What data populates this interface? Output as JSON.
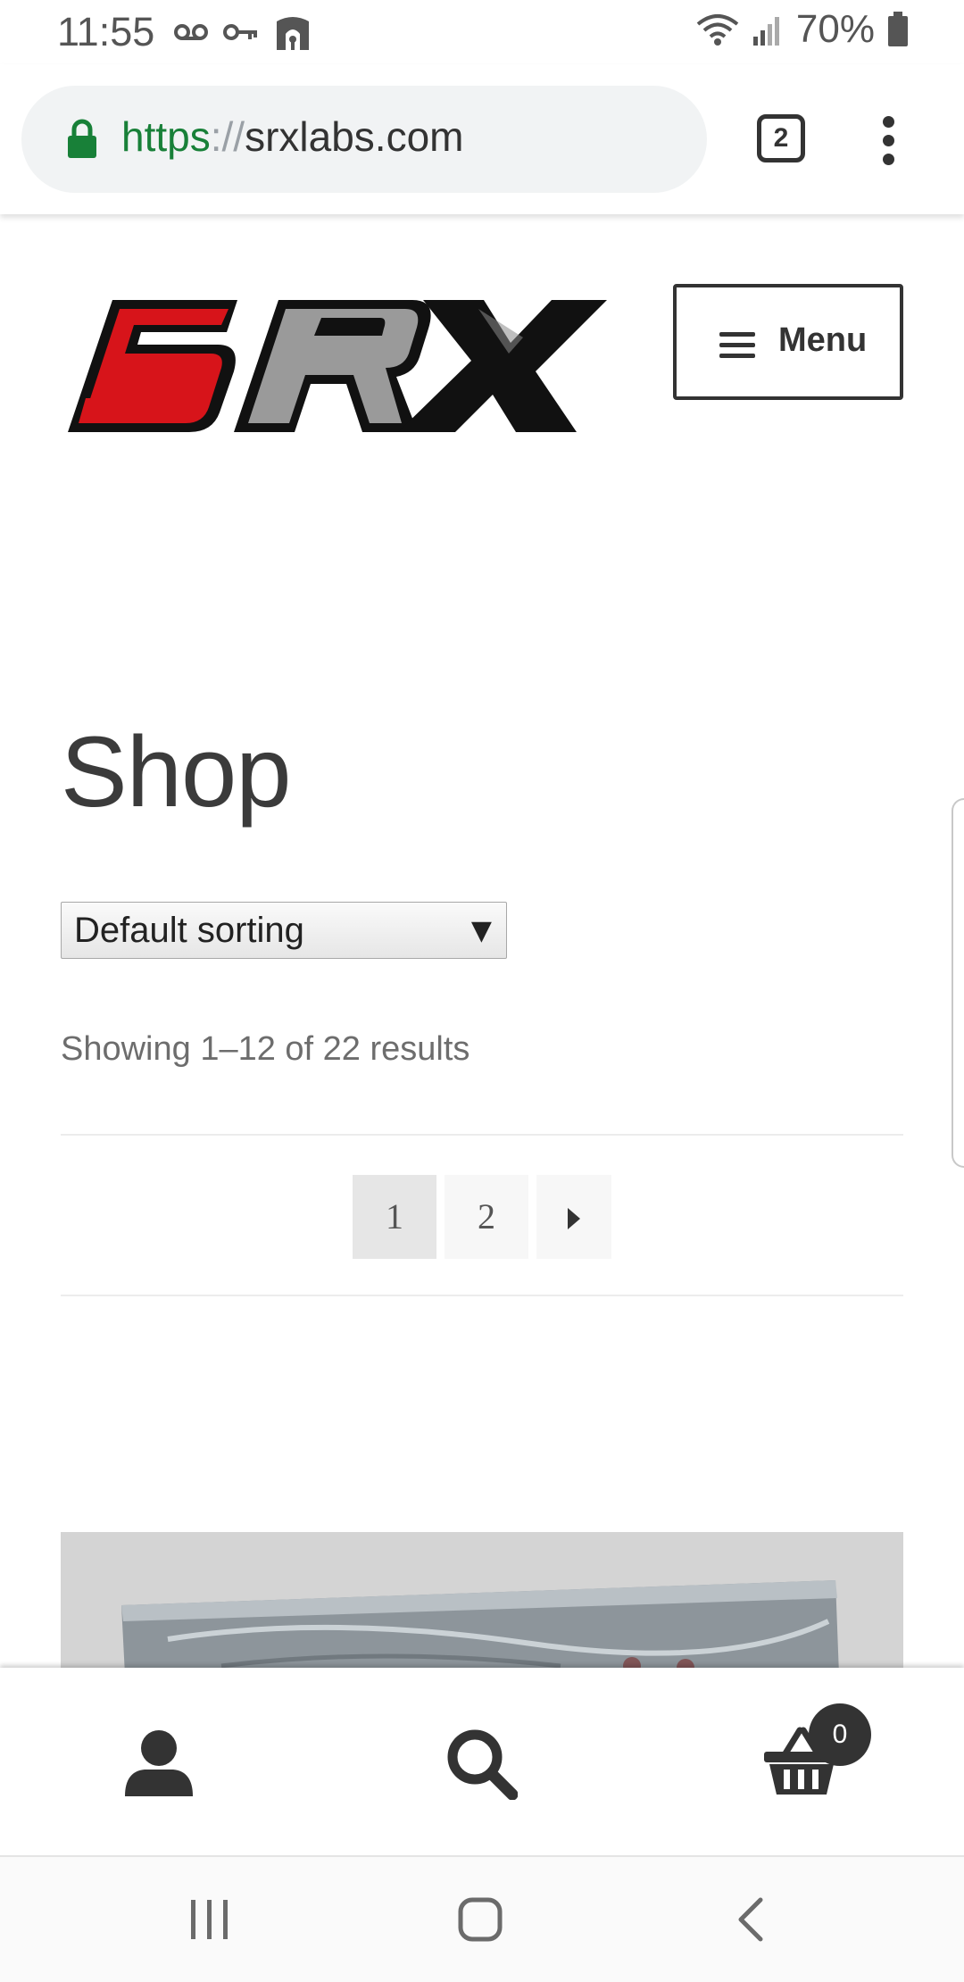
{
  "status_bar": {
    "time": "11:55",
    "battery": "70%",
    "left_icons": [
      "voicemail-icon",
      "key-icon",
      "shield-app-icon"
    ],
    "right_icons": [
      "wifi-icon",
      "signal-icon",
      "battery-icon"
    ]
  },
  "browser": {
    "url_scheme": "https",
    "url_separator": "://",
    "url_host": "srxlabs.com",
    "tab_count": "2",
    "lock_color": "#188038"
  },
  "header": {
    "logo_text": "SRX",
    "menu_label": "Menu"
  },
  "main": {
    "title": "Shop",
    "sort": {
      "selected": "Default sorting",
      "arrow": "▼"
    },
    "result_count": "Showing 1–12 of 22 results",
    "pagination": {
      "pages": [
        "1",
        "2"
      ],
      "current": "1"
    }
  },
  "footer": {
    "icons": [
      "account-icon",
      "search-icon",
      "cart-icon"
    ],
    "cart_count": "0"
  },
  "nav": {
    "buttons": [
      "recent-apps-icon",
      "home-icon",
      "back-icon"
    ]
  },
  "colors": {
    "logo_red": "#d7141a",
    "logo_gray": "#9a9a9a",
    "logo_black": "#111111",
    "text_dark": "#333333"
  }
}
